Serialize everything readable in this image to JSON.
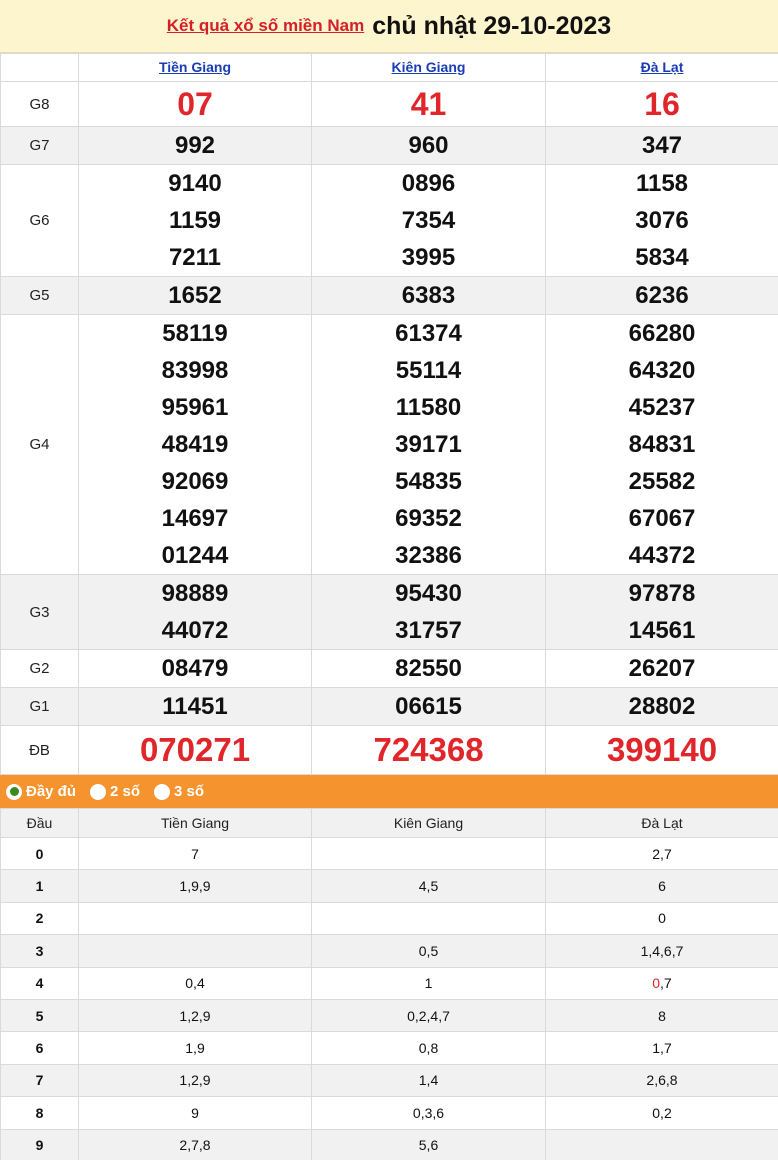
{
  "header": {
    "link_text": "Kết quả xổ số miền Nam",
    "date_text": "chủ nhật 29-10-2023"
  },
  "provinces": [
    "Tiền Giang",
    "Kiên Giang",
    "Đà Lạt"
  ],
  "prizes": [
    {
      "label": "G8",
      "values": [
        [
          "07"
        ],
        [
          "41"
        ],
        [
          "16"
        ]
      ]
    },
    {
      "label": "G7",
      "values": [
        [
          "992"
        ],
        [
          "960"
        ],
        [
          "347"
        ]
      ]
    },
    {
      "label": "G6",
      "values": [
        [
          "9140",
          "1159",
          "7211"
        ],
        [
          "0896",
          "7354",
          "3995"
        ],
        [
          "1158",
          "3076",
          "5834"
        ]
      ]
    },
    {
      "label": "G5",
      "values": [
        [
          "1652"
        ],
        [
          "6383"
        ],
        [
          "6236"
        ]
      ]
    },
    {
      "label": "G4",
      "values": [
        [
          "58119",
          "83998",
          "95961",
          "48419",
          "92069",
          "14697",
          "01244"
        ],
        [
          "61374",
          "55114",
          "11580",
          "39171",
          "54835",
          "69352",
          "32386"
        ],
        [
          "66280",
          "64320",
          "45237",
          "84831",
          "25582",
          "67067",
          "44372"
        ]
      ]
    },
    {
      "label": "G3",
      "values": [
        [
          "98889",
          "44072"
        ],
        [
          "95430",
          "31757"
        ],
        [
          "97878",
          "14561"
        ]
      ]
    },
    {
      "label": "G2",
      "values": [
        [
          "08479"
        ],
        [
          "82550"
        ],
        [
          "26207"
        ]
      ]
    },
    {
      "label": "G1",
      "values": [
        [
          "11451"
        ],
        [
          "06615"
        ],
        [
          "28802"
        ]
      ]
    },
    {
      "label": "ĐB",
      "values": [
        [
          "070271"
        ],
        [
          "724368"
        ],
        [
          "399140"
        ]
      ]
    }
  ],
  "filter": {
    "options": [
      "Đầy đủ",
      "2 số",
      "3 số"
    ],
    "selected": "Đầy đủ"
  },
  "loto": {
    "head_label": "Đầu",
    "rows": [
      {
        "dau": "0",
        "cells": [
          "7",
          "",
          "2,7"
        ]
      },
      {
        "dau": "1",
        "cells": [
          "1,9,9",
          "4,5",
          "6"
        ]
      },
      {
        "dau": "2",
        "cells": [
          "",
          "",
          "0"
        ]
      },
      {
        "dau": "3",
        "cells": [
          "",
          "0,5",
          "1,4,6,7"
        ]
      },
      {
        "dau": "4",
        "cells": [
          "0,4",
          "1",
          "0,7"
        ]
      },
      {
        "dau": "5",
        "cells": [
          "1,2,9",
          "0,2,4,7",
          "8"
        ]
      },
      {
        "dau": "6",
        "cells": [
          "1,9",
          "0,8",
          "1,7"
        ]
      },
      {
        "dau": "7",
        "cells": [
          "1,2,9",
          "1,4",
          "2,6,8"
        ]
      },
      {
        "dau": "8",
        "cells": [
          "9",
          "0,3,6",
          "0,2"
        ]
      },
      {
        "dau": "9",
        "cells": [
          "2,7,8",
          "5,6",
          ""
        ]
      }
    ],
    "highlights": [
      {
        "row": 4,
        "col": 2,
        "digit": 0
      },
      {
        "row": 6,
        "col": 1,
        "digit": 1
      },
      {
        "row": 7,
        "col": 0,
        "digit": 0
      }
    ]
  },
  "colors": {
    "accent_red": "#e0262a",
    "title_bg": "#fdf5cd",
    "filter_bg": "#f5932f",
    "province_link": "#1a3db5"
  }
}
